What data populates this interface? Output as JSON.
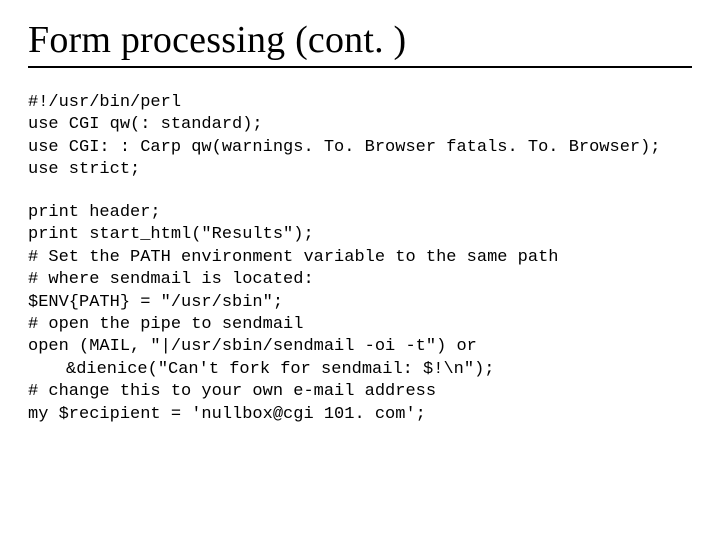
{
  "title": "Form processing (cont. )",
  "code1": {
    "l0": "#!/usr/bin/perl",
    "l1": "use CGI qw(: standard);",
    "l2": "use CGI: : Carp qw(warnings. To. Browser fatals. To. Browser);",
    "l3": "use strict;"
  },
  "code2": {
    "l0": "print header;",
    "l1": "print start_html(\"Results\");",
    "l2": "# Set the PATH environment variable to the same path",
    "l3": "# where sendmail is located:",
    "l4": "$ENV{PATH} = \"/usr/sbin\";",
    "l5": "# open the pipe to sendmail",
    "l6": "open (MAIL, \"|/usr/sbin/sendmail -oi -t\") or",
    "l7": "&dienice(\"Can't fork for sendmail: $!\\n\");",
    "l8": "# change this to your own e-mail address",
    "l9": "my $recipient = 'nullbox@cgi 101. com';"
  }
}
